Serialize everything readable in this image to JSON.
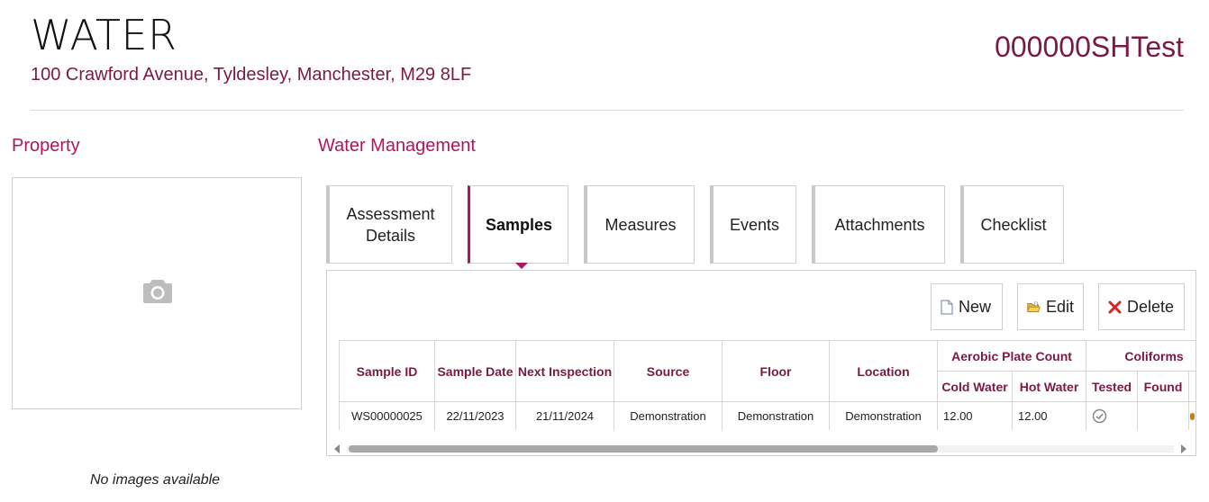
{
  "header": {
    "title": "WATER",
    "address": "100 Crawford Avenue, Tyldesley, Manchester, M29 8LF",
    "reference": "000000SHTest"
  },
  "property": {
    "section_title": "Property",
    "no_images_text": "No images available",
    "placeholder_icon": "camera-icon"
  },
  "water_management": {
    "section_title": "Water Management",
    "tabs": [
      {
        "label": "Assessment Details",
        "active": false
      },
      {
        "label": "Samples",
        "active": true
      },
      {
        "label": "Measures",
        "active": false
      },
      {
        "label": "Events",
        "active": false
      },
      {
        "label": "Attachments",
        "active": false
      },
      {
        "label": "Checklist",
        "active": false
      }
    ],
    "toolbar": {
      "new_label": "New",
      "edit_label": "Edit",
      "delete_label": "Delete"
    },
    "table": {
      "headers": {
        "sample_id": "Sample ID",
        "sample_date": "Sample Date",
        "next_inspection": "Next Inspection",
        "source": "Source",
        "floor": "Floor",
        "location": "Location",
        "aerobic_group": "Aerobic Plate Count",
        "aerobic_cold": "Cold Water",
        "aerobic_hot": "Hot Water",
        "coliforms_group": "Coliforms",
        "coliforms_tested": "Tested",
        "coliforms_found": "Found"
      },
      "rows": [
        {
          "sample_id": "WS00000025",
          "sample_date": "22/11/2023",
          "next_inspection": "21/11/2024",
          "source": "Demonstration",
          "floor": "Demonstration",
          "location": "Demonstration",
          "aerobic_cold": "12.00",
          "aerobic_hot": "12.00",
          "coliforms_tested_icon": "check-circle-icon"
        }
      ]
    }
  },
  "colors": {
    "accent": "#b0155e",
    "brand_dark": "#7a1a44"
  }
}
